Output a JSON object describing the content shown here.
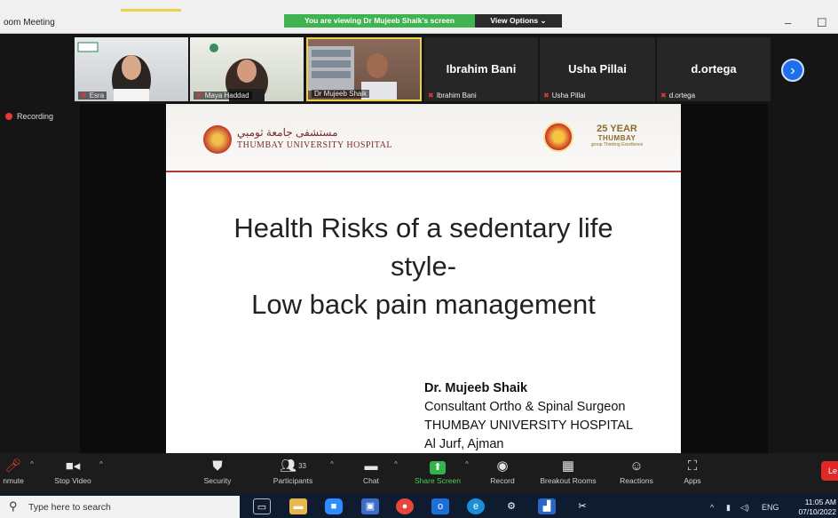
{
  "window": {
    "title": "oom Meeting",
    "minimize": "–",
    "maximize": "☐"
  },
  "banner": {
    "viewing_text": "You are viewing Dr Mujeeb Shaik's screen",
    "view_options": "View Options ⌄"
  },
  "participants_strip": [
    {
      "name": "Esra",
      "type": "video"
    },
    {
      "name": "Maya Haddad",
      "type": "video"
    },
    {
      "name": "Dr Mujeeb Shaik",
      "type": "video"
    },
    {
      "name": "Ibrahim Bani",
      "type": "name"
    },
    {
      "name": "Usha Pillai",
      "type": "name"
    },
    {
      "name": "d.ortega",
      "type": "name"
    }
  ],
  "recording": "Recording",
  "slide": {
    "hospital_arabic": "مستشفى جامعة ثومبي",
    "hospital_english": "THUMBAY UNIVERSITY HOSPITAL",
    "brand_top": "25 YEAR",
    "brand_name": "THUMBAY",
    "brand_tag": "group  Thinking Excellence",
    "title_lines": [
      "Health Risks of a sedentary life",
      "style-",
      "Low back pain management"
    ],
    "author_name": "Dr. Mujeeb Shaik",
    "author_lines": [
      "Consultant Ortho & Spinal Surgeon",
      "THUMBAY UNIVERSITY HOSPITAL",
      "Al Jurf, Ajman"
    ]
  },
  "toolbar": {
    "unmute": "nmute",
    "stop_video": "Stop Video",
    "security": "Security",
    "participants": "Participants",
    "participants_count": "33",
    "chat": "Chat",
    "share_screen": "Share Screen",
    "record": "Record",
    "breakout_rooms": "Breakout Rooms",
    "reactions": "Reactions",
    "apps": "Apps",
    "leave": "Le"
  },
  "taskbar": {
    "search_placeholder": "Type here to search",
    "language": "ENG",
    "time": "11:05 AM",
    "date": "07/10/2022"
  }
}
